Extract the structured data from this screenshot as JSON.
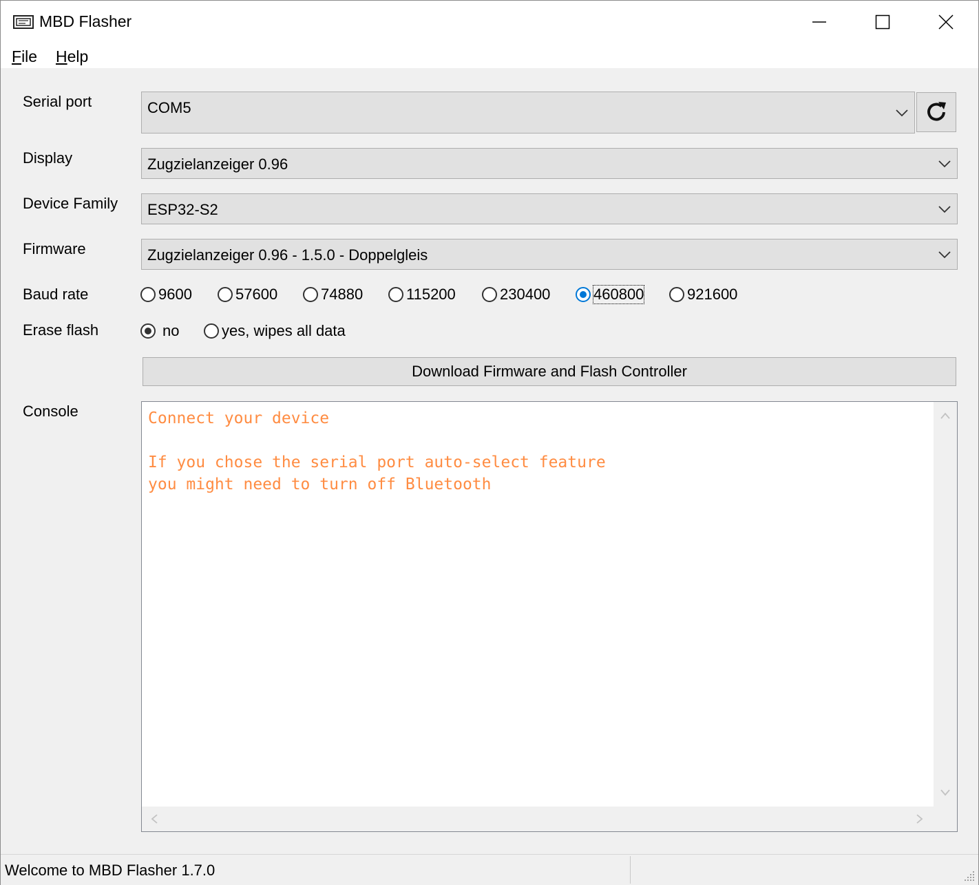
{
  "window": {
    "title": "MBD Flasher",
    "icon": "app-icon"
  },
  "menu": {
    "file": {
      "accel": "F",
      "rest": "ile"
    },
    "help": {
      "accel": "H",
      "rest": "elp"
    }
  },
  "form": {
    "serial_port": {
      "label": "Serial port",
      "value": "COM5"
    },
    "display": {
      "label": "Display",
      "value": "Zugzielanzeiger 0.96"
    },
    "device_family": {
      "label": "Device Family",
      "value": "ESP32-S2"
    },
    "firmware": {
      "label": "Firmware",
      "value": "Zugzielanzeiger 0.96 - 1.5.0 - Doppelgleis"
    },
    "baud_rate": {
      "label": "Baud rate",
      "options": [
        "9600",
        "57600",
        "74880",
        "115200",
        "230400",
        "460800",
        "921600"
      ],
      "selected": "460800"
    },
    "erase_flash": {
      "label": "Erase flash",
      "options": [
        "no",
        "yes, wipes all data"
      ],
      "selected": "no"
    },
    "flash_button": "Download Firmware and Flash Controller",
    "console": {
      "label": "Console",
      "lines": [
        "Connect your device",
        "",
        "If you chose the serial port auto-select feature",
        "you might need to turn off Bluetooth"
      ],
      "text_color": "#ff8c42"
    }
  },
  "status": {
    "text": "Welcome to MBD Flasher 1.7.0"
  },
  "colors": {
    "accent": "#0078d7",
    "control_bg": "#e1e1e1",
    "window_bg": "#f0f0f0"
  }
}
